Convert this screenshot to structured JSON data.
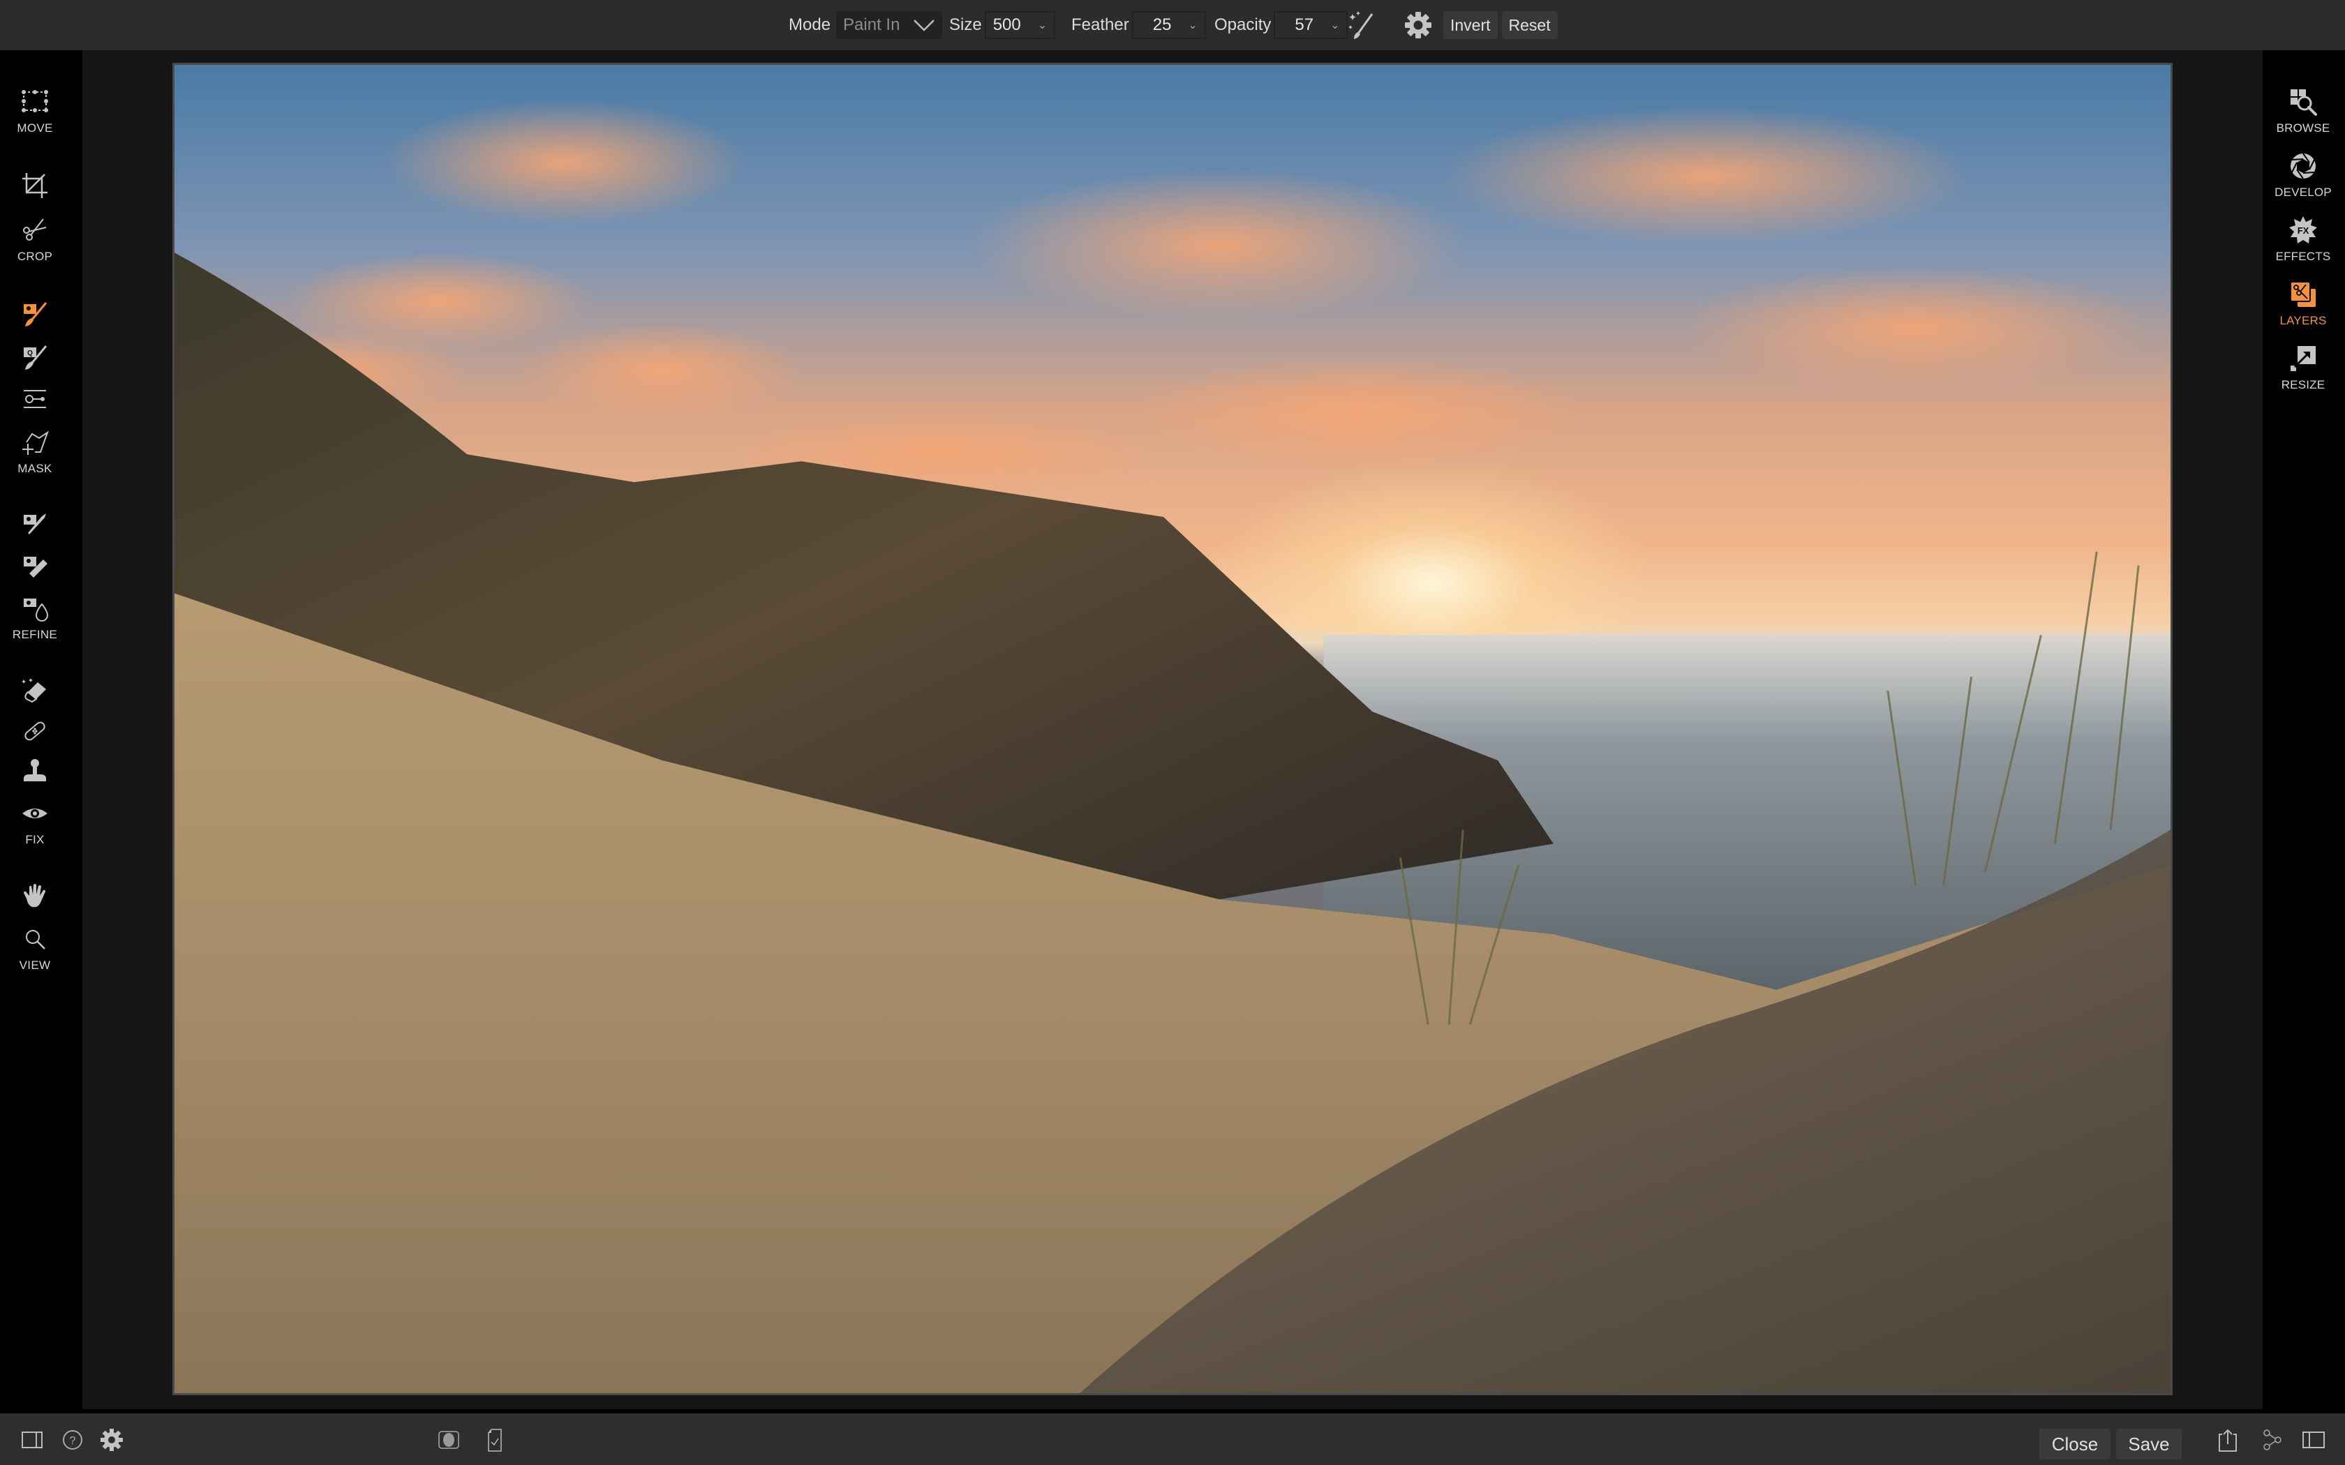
{
  "topbar": {
    "mode_label": "Mode",
    "mode_value": "Paint In",
    "size_label": "Size",
    "size_value": "500",
    "feather_label": "Feather",
    "feather_value": "25",
    "opacity_label": "Opacity",
    "opacity_value": "57",
    "magic_brush_icon": "magic-brush",
    "settings_icon": "gear",
    "invert_label": "Invert",
    "reset_label": "Reset"
  },
  "left_tools": [
    {
      "group": "MOVE",
      "items": [
        "move-transform"
      ]
    },
    {
      "group": "CROP",
      "items": [
        "crop",
        "cut-scissors"
      ]
    },
    {
      "group": "MASK",
      "items": [
        "paint-mask-brush",
        "quick-mask-brush",
        "gradient-mask",
        "polygon-lasso"
      ]
    },
    {
      "group": "REFINE",
      "items": [
        "chisel",
        "blur-mask",
        "color-range"
      ]
    },
    {
      "group": "FIX",
      "items": [
        "retouch-eraser",
        "heal-bandage",
        "clone-stamp",
        "red-eye"
      ]
    },
    {
      "group": "VIEW",
      "items": [
        "hand-pan",
        "zoom"
      ]
    }
  ],
  "left_labels": {
    "move": "MOVE",
    "crop": "CROP",
    "mask": "MASK",
    "refine": "REFINE",
    "fix": "FIX",
    "view": "VIEW"
  },
  "right_modules": [
    {
      "label": "BROWSE",
      "icon": "browse"
    },
    {
      "label": "DEVELOP",
      "icon": "aperture"
    },
    {
      "label": "EFFECTS",
      "icon": "fx-star"
    },
    {
      "label": "LAYERS",
      "icon": "layers",
      "active": true
    },
    {
      "label": "RESIZE",
      "icon": "resize"
    }
  ],
  "bottombar": {
    "close_label": "Close",
    "save_label": "Save"
  },
  "colors": {
    "accent": "#f3923a",
    "topbar_bg": "#2c2c2c",
    "canvas_bg": "#151515",
    "sidebar_bg": "#000000"
  }
}
